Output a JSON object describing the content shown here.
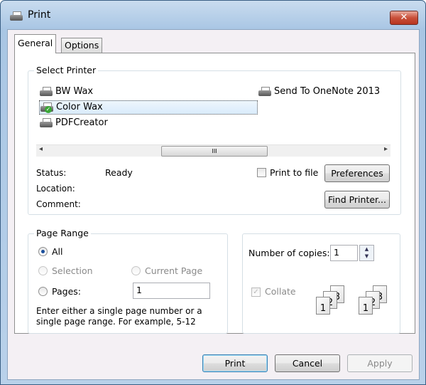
{
  "window": {
    "title": "Print",
    "close": "✕"
  },
  "tabs": [
    {
      "label": "General",
      "selected": true
    },
    {
      "label": "Options",
      "selected": false
    }
  ],
  "select_printer": {
    "label": "Select Printer",
    "printers": [
      {
        "name": "BW Wax",
        "selected": false,
        "default": false
      },
      {
        "name": "Color Wax",
        "selected": true,
        "default": true
      },
      {
        "name": "PDFCreator",
        "selected": false,
        "default": false
      },
      {
        "name": "Send To OneNote 2013",
        "selected": false,
        "default": false
      }
    ],
    "scroll_left": "◂",
    "scroll_right": "▸",
    "scroll_grip": "III",
    "status_label": "Status:",
    "status_value": "Ready",
    "location_label": "Location:",
    "comment_label": "Comment:",
    "print_to_file": {
      "label": "Print to file",
      "checked": false
    },
    "preferences": "Preferences",
    "find_printer": "Find Printer..."
  },
  "page_range": {
    "label": "Page Range",
    "all": "All",
    "selection": "Selection",
    "current_page": "Current Page",
    "pages": "Pages:",
    "pages_value": "1",
    "selected": "All",
    "hint": "Enter either a single page number or a single page range.  For example, 5-12"
  },
  "copies": {
    "label": "Number of copies:",
    "value": "1",
    "collate": {
      "label": "Collate",
      "checked": true,
      "enabled": false
    },
    "pages": [
      "1",
      "2",
      "3"
    ]
  },
  "buttons": {
    "print": "Print",
    "cancel": "Cancel",
    "apply": "Apply"
  }
}
